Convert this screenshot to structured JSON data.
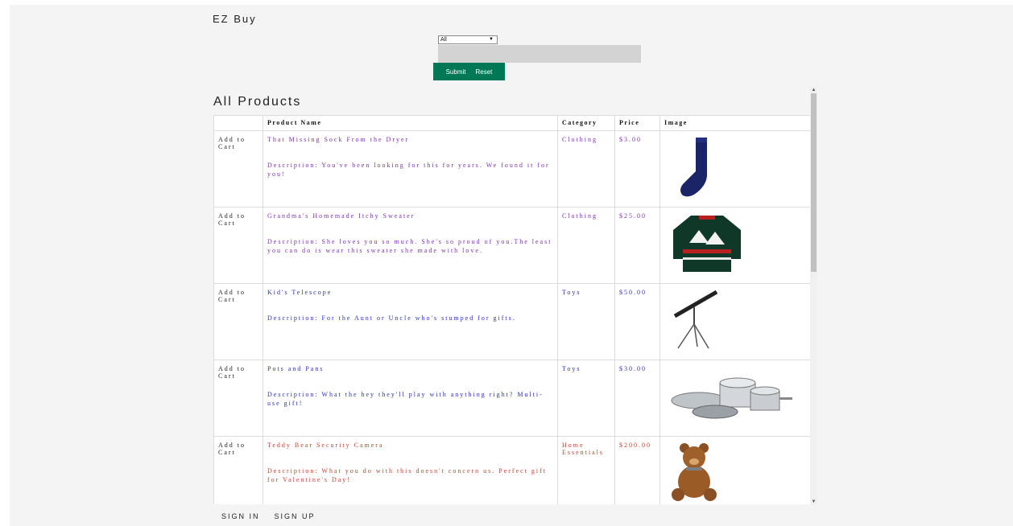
{
  "brand": "EZ Buy",
  "search": {
    "category_selected": "All",
    "query_value": "",
    "submit_label": "Submit",
    "reset_label": "Reset"
  },
  "section_title": "All Products",
  "table": {
    "headers": [
      "",
      "Product Name",
      "Category",
      "Price",
      "Image"
    ],
    "rows": [
      {
        "action": "Add to Cart",
        "name": "That Missing Sock From the Dryer",
        "description": "Description: You've been looking for this for years. We found it for you!",
        "category": "Clothing",
        "price": "$3.00",
        "image": "sock",
        "color": "#7a2fb0"
      },
      {
        "action": "Add to Cart",
        "name": "Grandma's Homemade Itchy Sweater",
        "description": "Description: She loves you so much. She's so proud of you.The least you can do is wear this sweater she made with love.",
        "category": "Clothing",
        "price": "$25.00",
        "image": "sweater",
        "color": "#7a2fb0"
      },
      {
        "action": "Add to Cart",
        "name": "Kid's Telescope",
        "description": "Description: For the Aunt or Uncle who's stumped for gifts.",
        "category": "Toys",
        "price": "$50.00",
        "image": "telescope",
        "color": "#2a2fb8"
      },
      {
        "action": "Add to Cart",
        "name": "Pots and Pans",
        "description": "Description: What the hey they'll play with anything right? Multi-use gift!",
        "category": "Toys",
        "price": "$30.00",
        "image": "pots-and-pans",
        "color": "#2a2fb8"
      },
      {
        "action": "Add to Cart",
        "name": "Teddy Bear Security Camera",
        "description": "Description: What you do with this doesn't concern us. Perfect gift for Valentine's Day!",
        "category": "Home Essentials",
        "price": "$200.00",
        "image": "teddy-bear",
        "color": "#c8402f"
      }
    ]
  },
  "footer": {
    "sign_in": "SIGN IN",
    "sign_up": "SIGN UP"
  },
  "colors": {
    "button_bg": "#007855",
    "input_bg": "#d3d3d3",
    "page_bg": "#f4f4f4"
  }
}
